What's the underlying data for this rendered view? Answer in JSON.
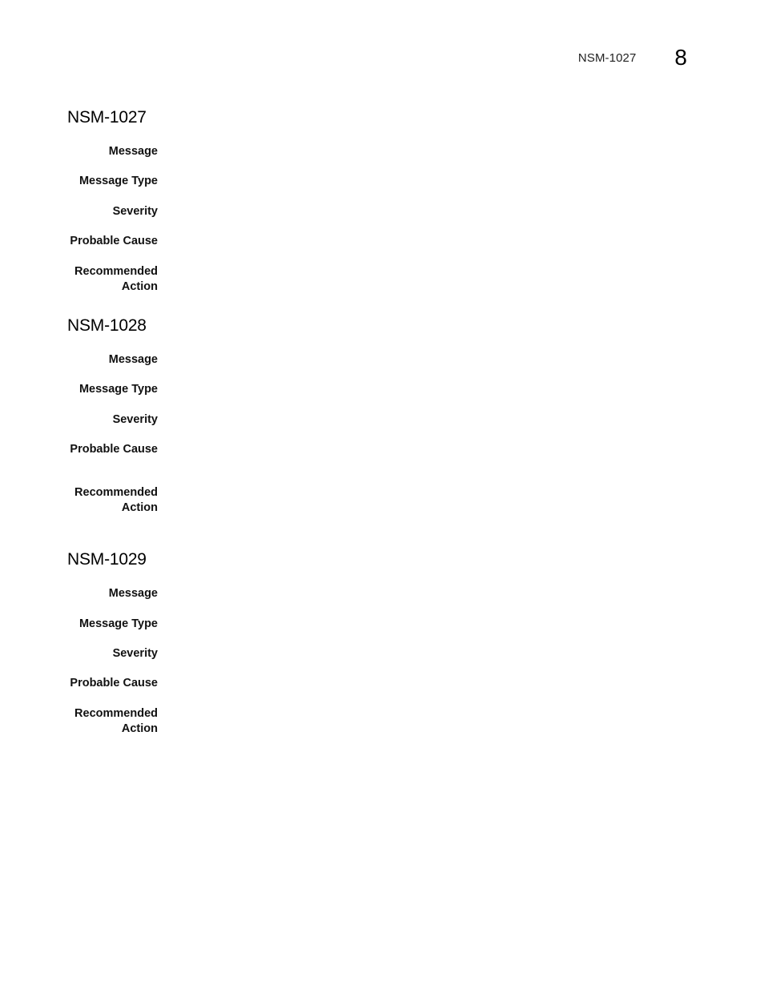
{
  "header": {
    "running_title": "NSM-1027",
    "chapter_number": "8"
  },
  "sections": [
    {
      "title": "NSM-1027",
      "fields": [
        {
          "label": "Message",
          "value": ""
        },
        {
          "label": "Message Type",
          "value": ""
        },
        {
          "label": "Severity",
          "value": ""
        },
        {
          "label": "Probable Cause",
          "value": ""
        },
        {
          "label": "Recommended Action",
          "value": ""
        }
      ]
    },
    {
      "title": "NSM-1028",
      "fields": [
        {
          "label": "Message",
          "value": ""
        },
        {
          "label": "Message Type",
          "value": ""
        },
        {
          "label": "Severity",
          "value": ""
        },
        {
          "label": "Probable Cause",
          "value": ""
        },
        {
          "label": "Recommended Action",
          "value": ""
        }
      ]
    },
    {
      "title": "NSM-1029",
      "fields": [
        {
          "label": "Message",
          "value": ""
        },
        {
          "label": "Message Type",
          "value": ""
        },
        {
          "label": "Severity",
          "value": ""
        },
        {
          "label": "Probable Cause",
          "value": ""
        },
        {
          "label": "Recommended Action",
          "value": ""
        }
      ]
    }
  ]
}
